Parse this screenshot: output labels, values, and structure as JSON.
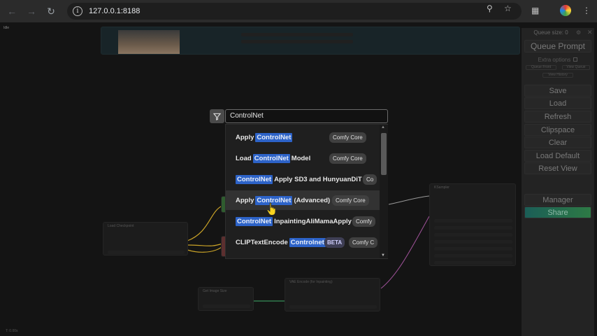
{
  "browser": {
    "url": "127.0.0.1:8188",
    "icons": [
      "back-arrow-icon",
      "forward-arrow-icon",
      "reload-icon",
      "info-icon",
      "zoom-icon",
      "bookmark-star-icon",
      "extensions-icon",
      "profile-avatar",
      "kebab-menu-icon"
    ]
  },
  "canvas": {
    "status": "Idle",
    "bottom_status": "T: 0.00s",
    "nodes": {
      "load_checkpoint": "Load Checkpoint",
      "ksampler": "KSampler",
      "get_image_size": "Get Image Size",
      "vae_encode": "VAE Encode (for Inpainting)"
    }
  },
  "panel": {
    "queue_size": "Queue size: 0",
    "queue_prompt": "Queue Prompt",
    "extra_options": "Extra options",
    "queue_front": "Queue Front",
    "view_queue": "View Queue",
    "view_history": "View History",
    "save": "Save",
    "load": "Load",
    "refresh": "Refresh",
    "clipspace": "Clipspace",
    "clear": "Clear",
    "load_default": "Load Default",
    "reset_view": "Reset View",
    "manager": "Manager",
    "share": "Share"
  },
  "search": {
    "query": "ControlNet",
    "results": [
      {
        "before": "Apply",
        "match": "ControlNet",
        "after": "",
        "badge": "Comfy Core"
      },
      {
        "before": "Load",
        "match": "ControlNet",
        "after": "Model",
        "badge": "Comfy Core"
      },
      {
        "before": "",
        "match": "ControlNet",
        "after": "Apply SD3 and HunyuanDiT",
        "badge": "Co"
      },
      {
        "before": "Apply",
        "match": "ControlNet",
        "after": "(Advanced)",
        "badge": "Comfy Core"
      },
      {
        "before": "",
        "match": "ControlNet",
        "after": "InpaintingAliMamaApply",
        "badge": "Comfy"
      },
      {
        "before": "CLIPTextEncode",
        "match": "Controlnet",
        "after": "",
        "beta": "BETA",
        "badge": "Comfy C"
      }
    ]
  }
}
